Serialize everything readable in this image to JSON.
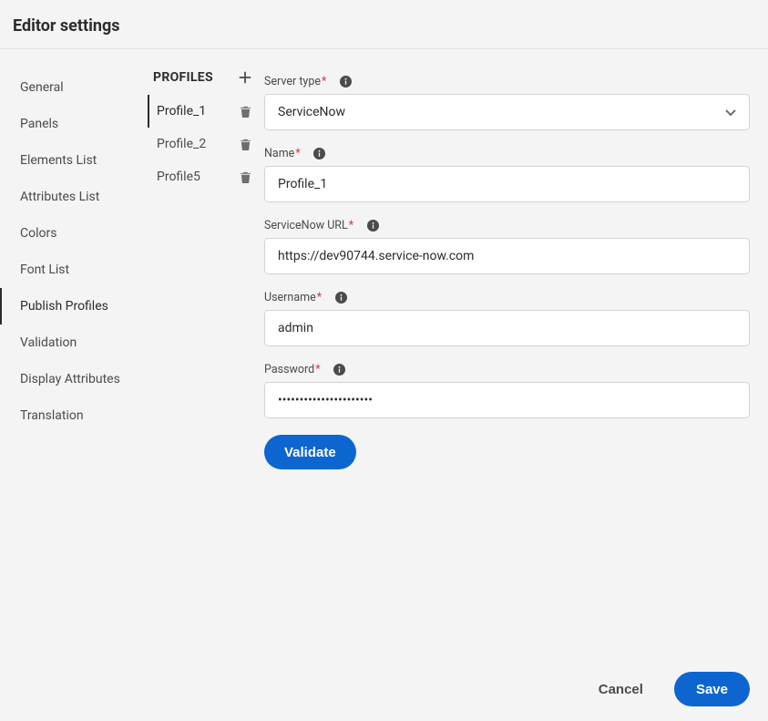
{
  "header": {
    "title": "Editor settings"
  },
  "nav": {
    "items": [
      {
        "label": "General"
      },
      {
        "label": "Panels"
      },
      {
        "label": "Elements List"
      },
      {
        "label": "Attributes List"
      },
      {
        "label": "Colors"
      },
      {
        "label": "Font List"
      },
      {
        "label": "Publish Profiles",
        "selected": true
      },
      {
        "label": "Validation"
      },
      {
        "label": "Display Attributes"
      },
      {
        "label": "Translation"
      }
    ]
  },
  "profiles": {
    "title": "PROFILES",
    "items": [
      {
        "label": "Profile_1",
        "selected": true
      },
      {
        "label": "Profile_2"
      },
      {
        "label": "Profile5"
      }
    ]
  },
  "form": {
    "server_type": {
      "label": "Server type",
      "value": "ServiceNow"
    },
    "name": {
      "label": "Name",
      "value": "Profile_1"
    },
    "url": {
      "label": "ServiceNow URL",
      "value": "https://dev90744.service-now.com"
    },
    "username": {
      "label": "Username",
      "value": "admin"
    },
    "password": {
      "label": "Password",
      "value": "••••••••••••••••••••••"
    },
    "validate_label": "Validate"
  },
  "footer": {
    "cancel_label": "Cancel",
    "save_label": "Save"
  }
}
